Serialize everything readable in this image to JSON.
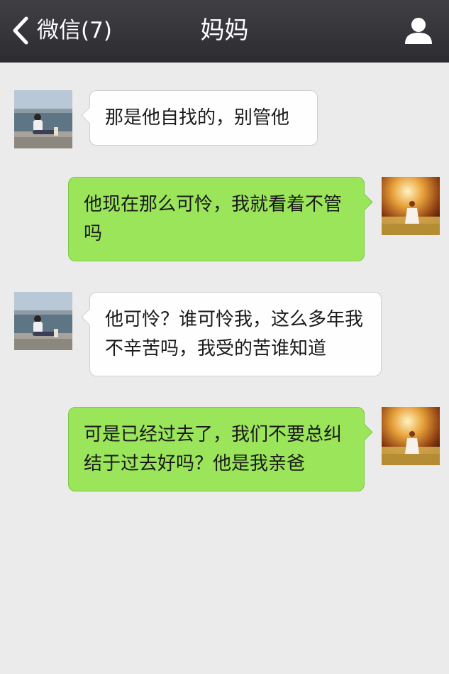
{
  "header": {
    "back_label": "微信(7)",
    "title": "妈妈",
    "profile_icon": "person-icon",
    "back_icon": "chevron-left-icon"
  },
  "colors": {
    "navbar": "#38383c",
    "background": "#ebebeb",
    "sent_bubble": "#9be55b",
    "received_bubble": "#fefefe"
  },
  "messages": [
    {
      "sender": "contact",
      "avatar": "contact-avatar",
      "text": "那是他自找的，别管他"
    },
    {
      "sender": "self",
      "avatar": "self-avatar",
      "text": "他现在那么可怜，我就看着不管吗"
    },
    {
      "sender": "contact",
      "avatar": "contact-avatar",
      "text": "他可怜？谁可怜我，这么多年我不辛苦吗，我受的苦谁知道"
    },
    {
      "sender": "self",
      "avatar": "self-avatar",
      "text": "可是已经过去了，我们不要总纠结于过去好吗？他是我亲爸"
    }
  ]
}
